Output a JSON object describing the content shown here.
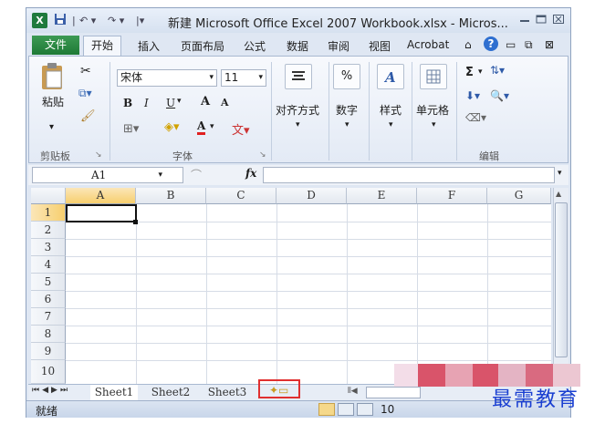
{
  "titlebar": {
    "app_icon": "X",
    "title": "新建 Microsoft Office Excel 2007 Workbook.xlsx - Micros...",
    "quick_access": [
      "save-icon",
      "undo-icon",
      "redo-icon",
      "customize-icon"
    ]
  },
  "tabs": {
    "file": "文件",
    "items": [
      "开始",
      "插入",
      "页面布局",
      "公式",
      "数据",
      "审阅",
      "视图",
      "Acrobat"
    ],
    "active": "开始"
  },
  "ribbon": {
    "clipboard": {
      "paste": "粘贴",
      "label": "剪贴板"
    },
    "font": {
      "name": "宋体",
      "size": "11",
      "label": "字体",
      "bold": "B",
      "italic": "I",
      "underline": "U",
      "grow": "A",
      "shrink": "A",
      "font_color": "A",
      "phonetic": "wén"
    },
    "alignment": {
      "label": "对齐方式"
    },
    "number": {
      "label": "数字",
      "symbol": "%"
    },
    "styles": {
      "label": "样式"
    },
    "cells": {
      "label": "单元格"
    },
    "editing": {
      "label": "编辑",
      "sum": "Σ"
    }
  },
  "formula_bar": {
    "name_box": "A1",
    "fx": "fx",
    "value": ""
  },
  "grid": {
    "columns": [
      "A",
      "B",
      "C",
      "D",
      "E",
      "F",
      "G"
    ],
    "rows": [
      "1",
      "2",
      "3",
      "4",
      "5",
      "6",
      "7",
      "8",
      "9",
      "10"
    ],
    "active_cell": "A1"
  },
  "sheets": {
    "tabs": [
      "Sheet1",
      "Sheet2",
      "Sheet3"
    ],
    "active": "Sheet1"
  },
  "status": {
    "ready": "就绪",
    "zoom": "10"
  },
  "watermark": {
    "text": "最需教育"
  },
  "colors": {
    "file_tab": "#2a8a44",
    "highlight": "#e03030",
    "watermark": "#1a3fd1"
  }
}
